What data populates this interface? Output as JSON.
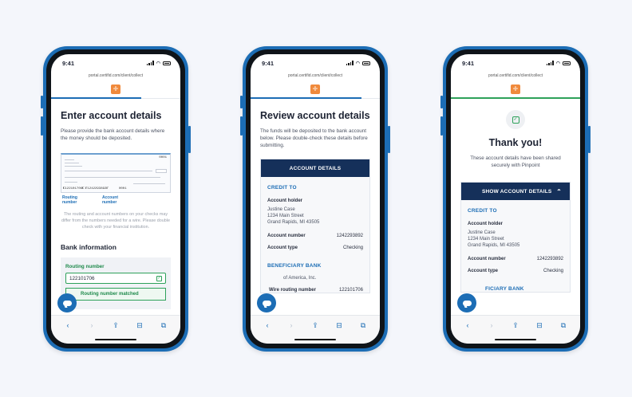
{
  "accent": "#1c6db5",
  "navy": "#15305a",
  "success": "#2ea15a",
  "phones": [
    {
      "time": "9:41",
      "url": "portal.certifid.com/client/collect",
      "title": "Enter account details",
      "description": "Please provide the bank account details where the money should be deposited.",
      "check": {
        "number": "0001",
        "routing_line": "⑆122101706⑆",
        "account_line": "⑈1242293892⑈",
        "check_no": "0001",
        "label_routing": "Routing number",
        "label_account": "Account number"
      },
      "check_note": "The routing and account numbers on your checks may differ from the numbers needed for a wire. Please double check with your financial institution.",
      "section": "Bank information",
      "field_label": "Routing number",
      "field_value": "122101706",
      "matched_text": "Routing number matched"
    },
    {
      "time": "9:41",
      "url": "portal.certifid.com/client/collect",
      "title": "Review account details",
      "description": "The funds will be deposited to the bank account below. Please double-check these details before submitting.",
      "card_header": "ACCOUNT DETAILS",
      "credit_to": "CREDIT TO",
      "holder_label": "Account holder",
      "holder_lines": [
        "Justine Case",
        "1234 Main Street",
        "Grand Rapids, MI 43505"
      ],
      "account_number_label": "Account number",
      "account_number": "1242293892",
      "account_type_label": "Account type",
      "account_type": "Checking",
      "beneficiary_bank": "BENEFICIARY BANK",
      "bank_name": "of America, Inc.",
      "wire_routing_label": "Wire routing number",
      "wire_routing": "122101706"
    },
    {
      "time": "9:41",
      "url": "portal.certifid.com/client/collect",
      "thanks_title": "Thank you!",
      "thanks_desc": "These account details have been shared securely with Pinpoint",
      "card_header": "SHOW ACCOUNT DETAILS",
      "credit_to": "CREDIT TO",
      "holder_label": "Account holder",
      "holder_lines": [
        "Justine Case",
        "1234 Main Street",
        "Grand Rapids, MI 43505"
      ],
      "account_number_label": "Account number",
      "account_number": "1242293892",
      "account_type_label": "Account type",
      "account_type": "Checking",
      "beneficiary_bank": "FICIARY BANK"
    }
  ],
  "toolbar_icons": [
    "back-icon",
    "forward-icon",
    "share-icon",
    "bookmarks-icon",
    "tabs-icon"
  ]
}
